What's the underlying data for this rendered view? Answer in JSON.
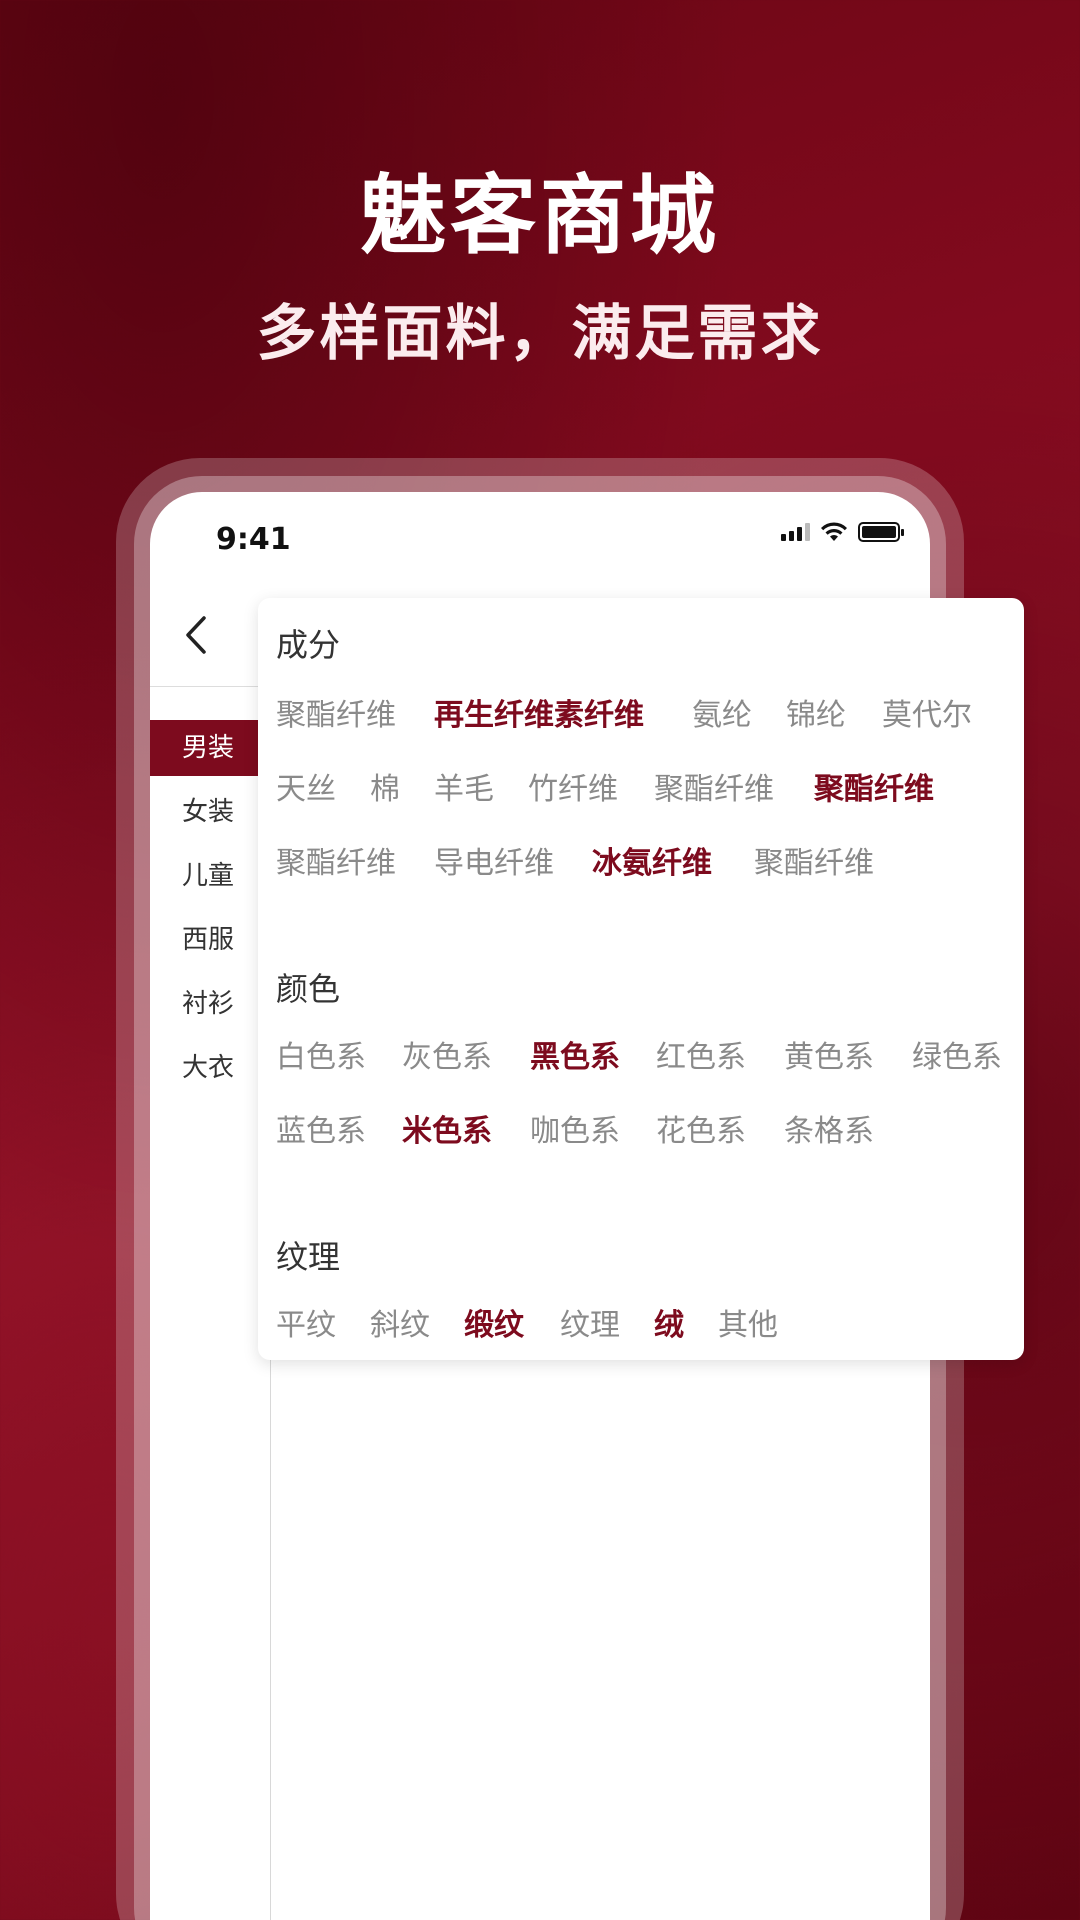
{
  "headline": {
    "title": "魅客商城",
    "subtitle": "多样面料，满足需求"
  },
  "status_bar": {
    "time": "9:41"
  },
  "categories": [
    {
      "label": "男装",
      "active": true
    },
    {
      "label": "女装",
      "active": false
    },
    {
      "label": "儿童",
      "active": false
    },
    {
      "label": "西服",
      "active": false
    },
    {
      "label": "衬衫",
      "active": false
    },
    {
      "label": "大衣",
      "active": false
    }
  ],
  "filter": {
    "composition": {
      "title": "成分",
      "options": [
        {
          "label": "聚酯纤维",
          "selected": false
        },
        {
          "label": "再生纤维素纤维",
          "selected": true
        },
        {
          "label": "氨纶",
          "selected": false
        },
        {
          "label": "锦纶",
          "selected": false
        },
        {
          "label": "莫代尔",
          "selected": false
        },
        {
          "label": "天丝",
          "selected": false
        },
        {
          "label": "棉",
          "selected": false
        },
        {
          "label": "羊毛",
          "selected": false
        },
        {
          "label": "竹纤维",
          "selected": false
        },
        {
          "label": "聚酯纤维",
          "selected": false
        },
        {
          "label": "聚酯纤维",
          "selected": true
        },
        {
          "label": "聚酯纤维",
          "selected": false
        },
        {
          "label": "导电纤维",
          "selected": false
        },
        {
          "label": "冰氨纤维",
          "selected": true
        },
        {
          "label": "聚酯纤维",
          "selected": false
        }
      ]
    },
    "color": {
      "title": "颜色",
      "options": [
        {
          "label": "白色系",
          "selected": false
        },
        {
          "label": "灰色系",
          "selected": false
        },
        {
          "label": "黑色系",
          "selected": true
        },
        {
          "label": "红色系",
          "selected": false
        },
        {
          "label": "黄色系",
          "selected": false
        },
        {
          "label": "绿色系",
          "selected": false
        },
        {
          "label": "蓝色系",
          "selected": false
        },
        {
          "label": "米色系",
          "selected": true
        },
        {
          "label": "咖色系",
          "selected": false
        },
        {
          "label": "花色系",
          "selected": false
        },
        {
          "label": "条格系",
          "selected": false
        }
      ]
    },
    "texture": {
      "title": "纹理",
      "options": [
        {
          "label": "平纹",
          "selected": false
        },
        {
          "label": "斜纹",
          "selected": false
        },
        {
          "label": "缎纹",
          "selected": true
        },
        {
          "label": "纹理",
          "selected": false
        },
        {
          "label": "绒",
          "selected": true
        },
        {
          "label": "其他",
          "selected": false
        }
      ]
    }
  },
  "colors": {
    "brand": "#7d0b1e",
    "tag_default": "#8a8a8a",
    "background": "#820a1e"
  },
  "icons": [
    "back-chevron-icon",
    "cellular-signal-icon",
    "wifi-icon",
    "battery-icon"
  ]
}
